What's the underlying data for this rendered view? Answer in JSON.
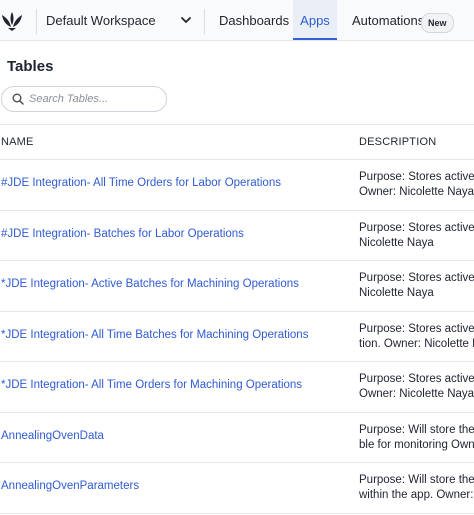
{
  "header": {
    "workspace": "Default Workspace",
    "tabs": [
      {
        "label": "Dashboards"
      },
      {
        "label": "Apps"
      },
      {
        "label": "Automations",
        "badge": "New"
      }
    ],
    "active_tab": "Apps",
    "accent_color": "#2f5bd3"
  },
  "page": {
    "title": "Tables",
    "search": {
      "placeholder": "Search Tables...",
      "value": ""
    }
  },
  "table": {
    "columns": [
      "NAME",
      "DESCRIPTION"
    ],
    "rows": [
      {
        "name": "#JDE Integration- All Time Orders for Labor Operations",
        "desc_line1": "Purpose: Stores active a",
        "desc_line2": "Owner: Nicolette Naya"
      },
      {
        "name": "#JDE Integration- Batches for Labor Operations",
        "desc_line1": "Purpose: Stores active c",
        "desc_line2": "Nicolette Naya"
      },
      {
        "name": "*JDE Integration- Active Batches for Machining Operations",
        "desc_line1": "Purpose: Stores active c",
        "desc_line2": "Nicolette Naya"
      },
      {
        "name": "*JDE Integration- All Time Batches for Machining Operations",
        "desc_line1": "Purpose: Stores active a",
        "desc_line2": "tion. Owner: Nicolette N"
      },
      {
        "name": "*JDE Integration- All Time Orders for Machining Operations",
        "desc_line1": "Purpose: Stores active a",
        "desc_line2": "Owner: Nicolette Naya"
      },
      {
        "name": "AnnealingOvenData",
        "desc_line1": "Purpose: Will store the",
        "desc_line2": "ble for monitoring Own"
      },
      {
        "name": "AnnealingOvenParameters",
        "desc_line1": "Purpose: Will store the",
        "desc_line2": "within the app. Owner:"
      }
    ]
  }
}
